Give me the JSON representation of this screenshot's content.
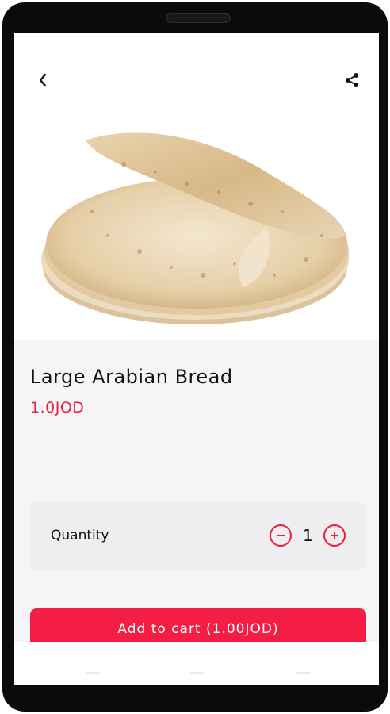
{
  "header": {
    "back_icon": "chevron-left-icon",
    "share_icon": "share-icon"
  },
  "product": {
    "title": "Large Arabian Bread",
    "price": "1.0JOD",
    "image": "arabian-bread-photo"
  },
  "quantity": {
    "label": "Quantity",
    "value": "1",
    "decrease_icon": "minus-circle-icon",
    "increase_icon": "plus-circle-icon"
  },
  "cart": {
    "button_label": "Add to cart (1.00JOD)"
  },
  "colors": {
    "accent": "#ee1d3d",
    "panel": "#f5f4f6",
    "card": "#eeedf0"
  }
}
